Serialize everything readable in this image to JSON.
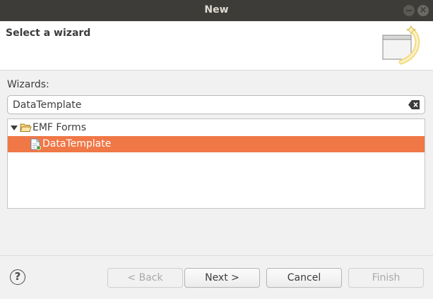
{
  "window": {
    "title": "New",
    "minimize_glyph": "",
    "close_glyph": "×"
  },
  "banner": {
    "heading": "Select a wizard",
    "icon": "new-wizard-icon"
  },
  "wizards": {
    "label": "Wizards:",
    "filter_value": "DataTemplate",
    "clear_icon": "clear-filter-icon"
  },
  "tree": {
    "folder": {
      "label": "EMF Forms",
      "expanded": true,
      "icon": "folder-open-icon"
    },
    "items": [
      {
        "label": "DataTemplate",
        "selected": true,
        "icon": "file-new-icon"
      }
    ],
    "selection_color": "#f07746"
  },
  "buttons": {
    "help": "?",
    "back": "< Back",
    "next": "Next >",
    "cancel": "Cancel",
    "finish": "Finish"
  }
}
